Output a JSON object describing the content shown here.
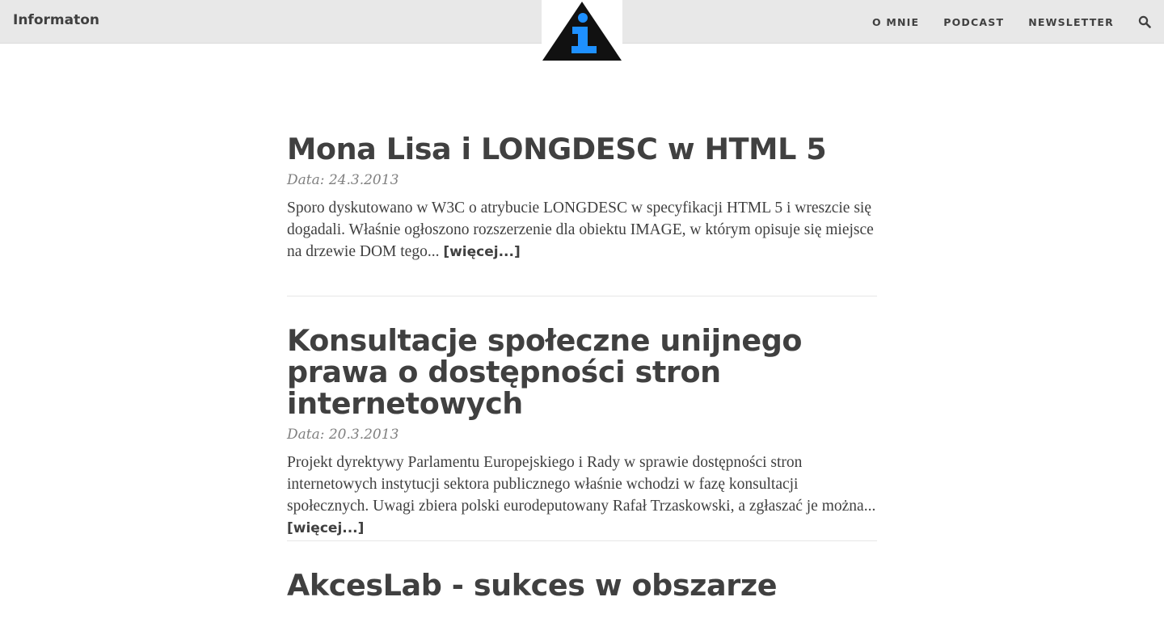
{
  "header": {
    "brand": "Informaton",
    "nav": [
      "O MNIE",
      "PODCAST",
      "NEWSLETTER"
    ],
    "search_icon": "search-icon",
    "logo": "info-triangle-logo"
  },
  "colors": {
    "topbar": "#e8e8e8",
    "logo_black": "#111111",
    "logo_blue": "#1e90ff",
    "text": "#404040",
    "meta": "#808080"
  },
  "posts": [
    {
      "title": "Mona Lisa i LONGDESC w HTML 5",
      "date": "Data: 24.3.2013",
      "excerpt": "Sporo dyskutowano w W3C o atrybucie LONGDESC w specyfikacji HTML 5 i wreszcie się dogadali. Właśnie ogłoszono rozszerzenie dla obiektu IMAGE, w którym opisuje się miejsce na drzewie DOM tego... ",
      "more": "[więcej...]"
    },
    {
      "title": "Konsultacje społeczne unijnego prawa o dostępności stron internetowych",
      "date": "Data: 20.3.2013",
      "excerpt": "Projekt dyrektywy Parlamentu Europejskiego i Rady w sprawie dostępności stron internetowych instytucji sektora publicznego właśnie wchodzi w fazę konsultacji społecznych. Uwagi zbiera polski eurodeputowany Rafał Trzaskowski, a zgłaszać je można... ",
      "more": "[więcej...]"
    },
    {
      "title": "AkcesLab - sukces w obszarze"
    }
  ]
}
